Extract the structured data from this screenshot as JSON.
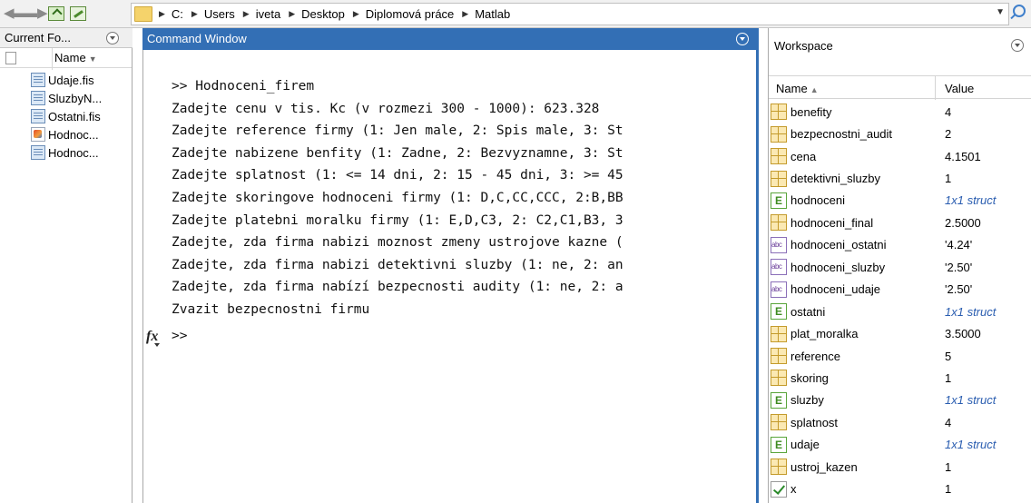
{
  "toolbar": {
    "back_icon": "back-arrow-icon",
    "forward_icon": "forward-arrow-icon",
    "path": [
      "C:",
      "Users",
      "iveta",
      "Desktop",
      "Diplomová práce",
      "Matlab"
    ]
  },
  "current_folder": {
    "title": "Current Fo...",
    "column_name": "Name",
    "files": [
      {
        "name": "Udaje.fis",
        "icon": "doc"
      },
      {
        "name": "SluzbyN...",
        "icon": "doc"
      },
      {
        "name": "Ostatni.fis",
        "icon": "doc"
      },
      {
        "name": "Hodnoc...",
        "icon": "mfile"
      },
      {
        "name": "Hodnoc...",
        "icon": "doc"
      }
    ]
  },
  "command_window": {
    "title": "Command Window",
    "lines": [
      ">> Hodnoceni_firem",
      "Zadejte cenu v tis. Kc (v rozmezi 300 - 1000): 623.328",
      "Zadejte reference firmy (1: Jen male, 2: Spis male, 3: St",
      "Zadejte nabizene benfity (1: Zadne, 2: Bezvyznamne, 3: St",
      "Zadejte splatnost (1: <= 14 dni, 2: 15 - 45 dni, 3: >= 45",
      "Zadejte skoringove hodnoceni firmy (1: D,C,CC,CCC, 2:B,BB",
      "Zadejte platebni moralku firmy (1: E,D,C3, 2: C2,C1,B3, 3",
      "Zadejte, zda firma nabizi moznost zmeny ustrojove kazne (",
      "Zadejte, zda firma nabizi detektivni sluzby (1: ne, 2: an",
      "Zadejte, zda firma nabízí bezpecnosti audity (1: ne, 2: a",
      "Zvazit bezpecnostni firmu"
    ],
    "prompt": ">>",
    "fx": "fx"
  },
  "workspace": {
    "title": "Workspace",
    "column_name": "Name",
    "column_value": "Value",
    "variables": [
      {
        "name": "benefity",
        "value": "4",
        "type": "grid"
      },
      {
        "name": "bezpecnostni_audit",
        "value": "2",
        "type": "grid"
      },
      {
        "name": "cena",
        "value": "4.1501",
        "type": "grid"
      },
      {
        "name": "detektivni_sluzby",
        "value": "1",
        "type": "grid"
      },
      {
        "name": "hodnoceni",
        "value": "1x1 struct",
        "type": "struct"
      },
      {
        "name": "hodnoceni_final",
        "value": "2.5000",
        "type": "grid"
      },
      {
        "name": "hodnoceni_ostatni",
        "value": "'4.24'",
        "type": "char"
      },
      {
        "name": "hodnoceni_sluzby",
        "value": "'2.50'",
        "type": "char"
      },
      {
        "name": "hodnoceni_udaje",
        "value": "'2.50'",
        "type": "char"
      },
      {
        "name": "ostatni",
        "value": "1x1 struct",
        "type": "struct"
      },
      {
        "name": "plat_moralka",
        "value": "3.5000",
        "type": "grid"
      },
      {
        "name": "reference",
        "value": "5",
        "type": "grid"
      },
      {
        "name": "skoring",
        "value": "1",
        "type": "grid"
      },
      {
        "name": "sluzby",
        "value": "1x1 struct",
        "type": "struct"
      },
      {
        "name": "splatnost",
        "value": "4",
        "type": "grid"
      },
      {
        "name": "udaje",
        "value": "1x1 struct",
        "type": "struct"
      },
      {
        "name": "ustroj_kazen",
        "value": "1",
        "type": "grid"
      },
      {
        "name": "x",
        "value": "1",
        "type": "logical"
      }
    ]
  }
}
